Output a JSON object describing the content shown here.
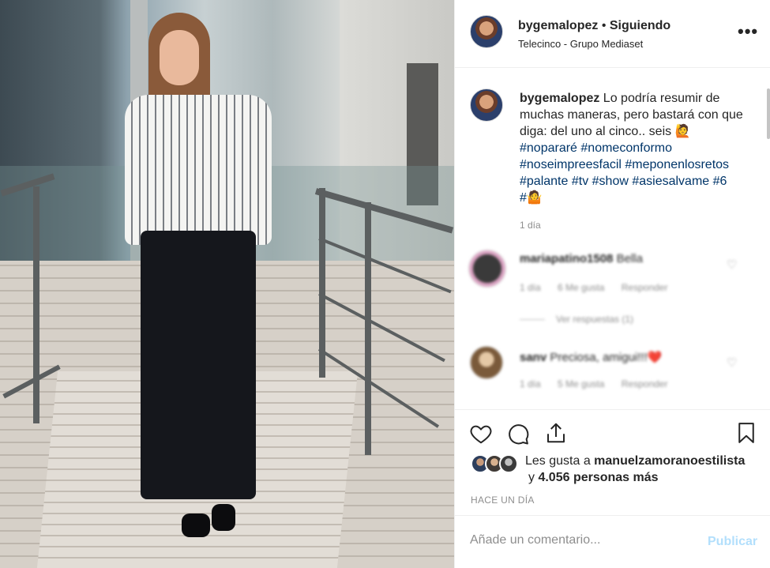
{
  "header": {
    "username": "bygemalopez",
    "separator": "•",
    "follow_status": "Siguiendo",
    "location": "Telecinco - Grupo Mediaset",
    "more_icon": "more-horizontal-icon",
    "more_label": "•••"
  },
  "caption": {
    "username": "bygemalopez",
    "text": " Lo podría resumir de muchas maneras, pero bastará con que diga: del uno al cinco.. seis 🙋",
    "hashtags": [
      "#nopararé",
      "#nomeconformo",
      "#noseimpreesfacil",
      "#meponenlosretos",
      "#palante",
      "#tv",
      "#show",
      "#asiesalvame",
      "#6",
      "#🤷"
    ],
    "time": "1 día"
  },
  "comments": [
    {
      "username": "mariapatino1508",
      "text": "Bella",
      "time": "1 día",
      "likes": "6 Me gusta",
      "reply": "Responder",
      "view_replies": "Ver respuestas (1)"
    },
    {
      "username": "sanv",
      "text": "Preciosa, amigui!!!❤️",
      "time": "1 día",
      "likes": "5 Me gusta",
      "reply": "Responder"
    }
  ],
  "actions": {
    "like_icon": "heart-icon",
    "comment_icon": "comment-icon",
    "share_icon": "share-icon",
    "save_icon": "bookmark-icon"
  },
  "likes": {
    "prefix": "Les gusta a ",
    "user": "manuelzamoranoestilista",
    "conj": "y ",
    "others": "4.056 personas más"
  },
  "posted_ago": "HACE UN DÍA",
  "add_comment": {
    "placeholder": "Añade un comentario...",
    "submit": "Publicar"
  },
  "colors": {
    "hashtag": "#003569",
    "muted": "#8e8e8e",
    "publish_disabled": "#b2dffc"
  }
}
